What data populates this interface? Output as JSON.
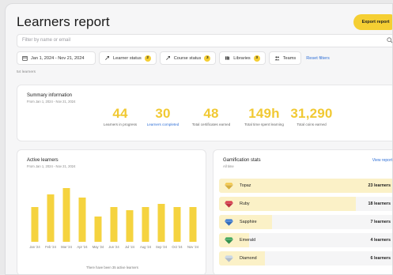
{
  "header": {
    "title": "Learners report",
    "export_label": "Export report"
  },
  "search": {
    "placeholder": "Filter by name or email"
  },
  "filters": {
    "date_range": "Jan 1, 2024 - Nov 21, 2024",
    "learner_status": "Learner status",
    "learner_status_count": "2",
    "course_status": "Course status",
    "course_status_count": "3",
    "libraries": "Libraries",
    "libraries_count": "3",
    "teams": "Teams",
    "reset": "Reset filters"
  },
  "learner_count": "54 learners",
  "summary": {
    "title": "Summary information",
    "subtitle": "From Jan 1, 2024 - Nov 21, 2024",
    "stats": [
      {
        "value": "44",
        "label": "Learners in progress"
      },
      {
        "value": "30",
        "label": "Learners completed"
      },
      {
        "value": "48",
        "label": "Total certificates earned"
      },
      {
        "value": "149h",
        "label": "Total time spent learning"
      },
      {
        "value": "31,290",
        "label": "Total coins earned"
      }
    ]
  },
  "active_learners": {
    "title": "Active learners",
    "subtitle": "From Jan 1, 2024 - Nov 21, 2024",
    "footer": "There have been 35 active learners"
  },
  "chart_data": {
    "type": "bar",
    "title": "Active learners",
    "categories": [
      "Jan '24",
      "Feb '24",
      "Mar '24",
      "Apr '24",
      "May '24",
      "Jun '24",
      "Jul '24",
      "Aug '24",
      "Sep '24",
      "Oct '24",
      "Nov '24"
    ],
    "values": [
      11,
      15,
      17,
      14,
      8,
      11,
      10,
      11,
      12,
      11,
      11
    ],
    "ylim": [
      0,
      22
    ],
    "grid": false,
    "color": "#f5d33f"
  },
  "gamification": {
    "title": "Gamification stats",
    "subtitle": "All time",
    "view_label": "View report",
    "rows": [
      {
        "name": "Topaz",
        "value": "23 learners",
        "fill": 1.0,
        "icon": "topaz-gem-icon",
        "color": "#f3c547"
      },
      {
        "name": "Ruby",
        "value": "18 learners",
        "fill": 0.78,
        "icon": "ruby-gem-icon",
        "color": "#d93a4a"
      },
      {
        "name": "Sapphire",
        "value": "7 learners",
        "fill": 0.3,
        "icon": "sapphire-gem-icon",
        "color": "#3a7bd5"
      },
      {
        "name": "Emerald",
        "value": "4 learners",
        "fill": 0.17,
        "icon": "emerald-gem-icon",
        "color": "#3aa55a"
      },
      {
        "name": "Diamond",
        "value": "6 learners",
        "fill": 0.26,
        "icon": "diamond-gem-icon",
        "color": "#c9d7e6"
      }
    ]
  }
}
